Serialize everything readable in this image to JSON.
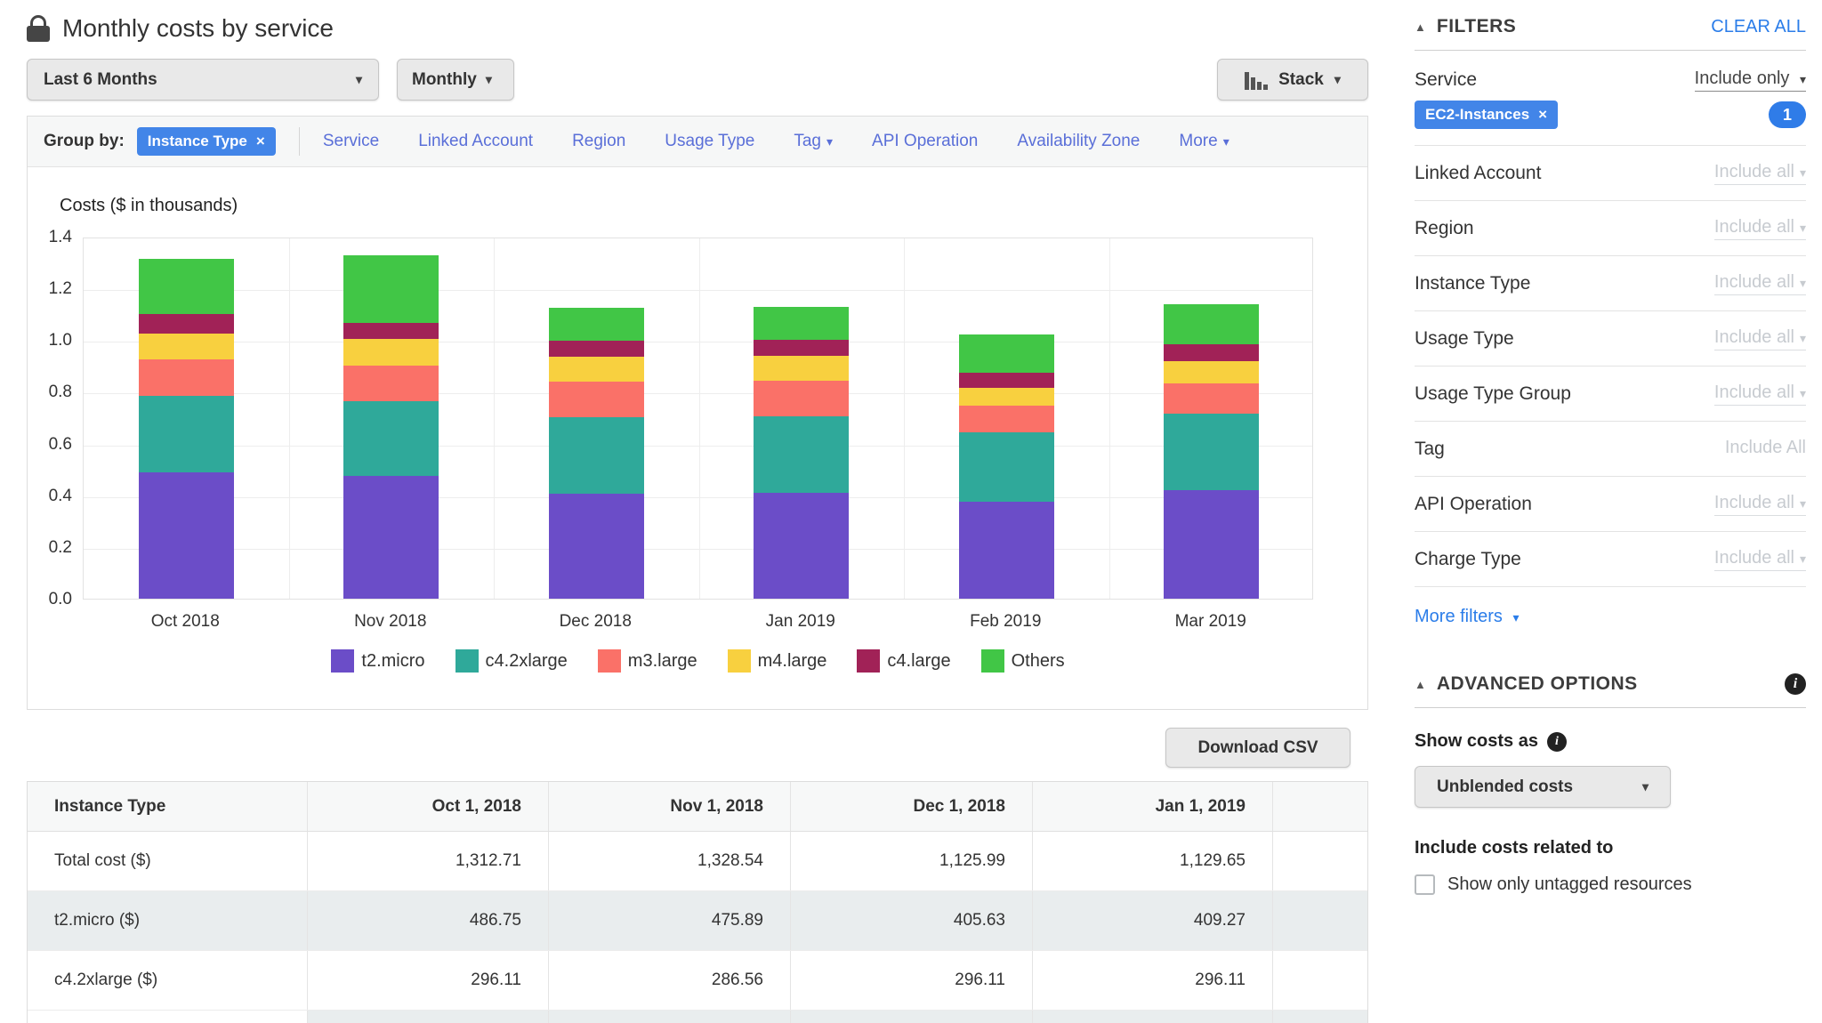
{
  "icons": {
    "caret_down": "▾",
    "triangle_up": "▲",
    "close": "×",
    "info": "i"
  },
  "colors": {
    "accent_blue": "#2b7de9",
    "pill_blue": "#4285e8",
    "link_indigo": "#5a6fd8"
  },
  "header": {
    "title": "Monthly costs by service"
  },
  "toolbar": {
    "time_range": "Last 6 Months",
    "granularity": "Monthly",
    "chart_style": "Stack"
  },
  "group_by": {
    "label": "Group by:",
    "selected": "Instance Type",
    "links": [
      {
        "label": "Service",
        "caret": false
      },
      {
        "label": "Linked Account",
        "caret": false
      },
      {
        "label": "Region",
        "caret": false
      },
      {
        "label": "Usage Type",
        "caret": false
      },
      {
        "label": "Tag",
        "caret": true
      },
      {
        "label": "API Operation",
        "caret": false
      },
      {
        "label": "Availability Zone",
        "caret": false
      },
      {
        "label": "More",
        "caret": true
      }
    ]
  },
  "chart_data": {
    "type": "bar",
    "stacked": true,
    "title": "Costs ($ in thousands)",
    "categories": [
      "Oct 2018",
      "Nov 2018",
      "Dec 2018",
      "Jan 2019",
      "Feb 2019",
      "Mar 2019"
    ],
    "series": [
      {
        "name": "t2.micro",
        "color": "#6b4dc8",
        "values": [
          0.487,
          0.476,
          0.406,
          0.409,
          0.375,
          0.42
        ]
      },
      {
        "name": "c4.2xlarge",
        "color": "#2fa99a",
        "values": [
          0.296,
          0.287,
          0.296,
          0.296,
          0.27,
          0.296
        ]
      },
      {
        "name": "m3.large",
        "color": "#fa7168",
        "values": [
          0.143,
          0.14,
          0.138,
          0.138,
          0.1,
          0.115
        ]
      },
      {
        "name": "m4.large",
        "color": "#f8d03f",
        "values": [
          0.1,
          0.1,
          0.095,
          0.095,
          0.07,
          0.088
        ]
      },
      {
        "name": "c4.large",
        "color": "#a12257",
        "values": [
          0.074,
          0.065,
          0.062,
          0.062,
          0.06,
          0.065
        ]
      },
      {
        "name": "Others",
        "color": "#41c646",
        "values": [
          0.213,
          0.261,
          0.129,
          0.13,
          0.145,
          0.156
        ]
      }
    ],
    "ylim": [
      0,
      1.4
    ],
    "yticks": [
      "1.4",
      "1.2",
      "1.0",
      "0.8",
      "0.6",
      "0.4",
      "0.2",
      "0.0"
    ],
    "grid": true,
    "legend_position": "bottom"
  },
  "actions": {
    "download": "Download CSV"
  },
  "table": {
    "columns": [
      "Instance Type",
      "Oct 1, 2018",
      "Nov 1, 2018",
      "Dec 1, 2018",
      "Jan 1, 2019",
      ""
    ],
    "rows": [
      {
        "label": "Total cost ($)",
        "values": [
          "1,312.71",
          "1,328.54",
          "1,125.99",
          "1,129.65"
        ],
        "shaded": false,
        "partial": false
      },
      {
        "label": "t2.micro ($)",
        "values": [
          "486.75",
          "475.89",
          "405.63",
          "409.27"
        ],
        "shaded": true,
        "partial": false
      },
      {
        "label": "c4.2xlarge ($)",
        "values": [
          "296.11",
          "286.56",
          "296.11",
          "296.11"
        ],
        "shaded": false,
        "partial": false
      },
      {
        "label": "",
        "values": [
          "",
          "",
          "",
          ""
        ],
        "shaded": true,
        "partial": true
      }
    ]
  },
  "filters": {
    "heading": "FILTERS",
    "clear_all": "CLEAR ALL",
    "service": {
      "label": "Service",
      "mode": "Include only",
      "tag": "EC2-Instances",
      "count": "1"
    },
    "rows": [
      {
        "label": "Linked Account",
        "value": "Include all",
        "caret": true
      },
      {
        "label": "Region",
        "value": "Include all",
        "caret": true
      },
      {
        "label": "Instance Type",
        "value": "Include all",
        "caret": true
      },
      {
        "label": "Usage Type",
        "value": "Include all",
        "caret": true
      },
      {
        "label": "Usage Type Group",
        "value": "Include all",
        "caret": true
      },
      {
        "label": "Tag",
        "value": "Include All",
        "caret": false
      },
      {
        "label": "API Operation",
        "value": "Include all",
        "caret": true
      },
      {
        "label": "Charge Type",
        "value": "Include all",
        "caret": true
      }
    ],
    "more_filters": "More filters"
  },
  "advanced": {
    "heading": "ADVANCED OPTIONS",
    "show_costs_as": "Show costs as",
    "selected_cost_type": "Unblended costs",
    "include_heading": "Include costs related to",
    "untagged_label": "Show only untagged resources"
  }
}
